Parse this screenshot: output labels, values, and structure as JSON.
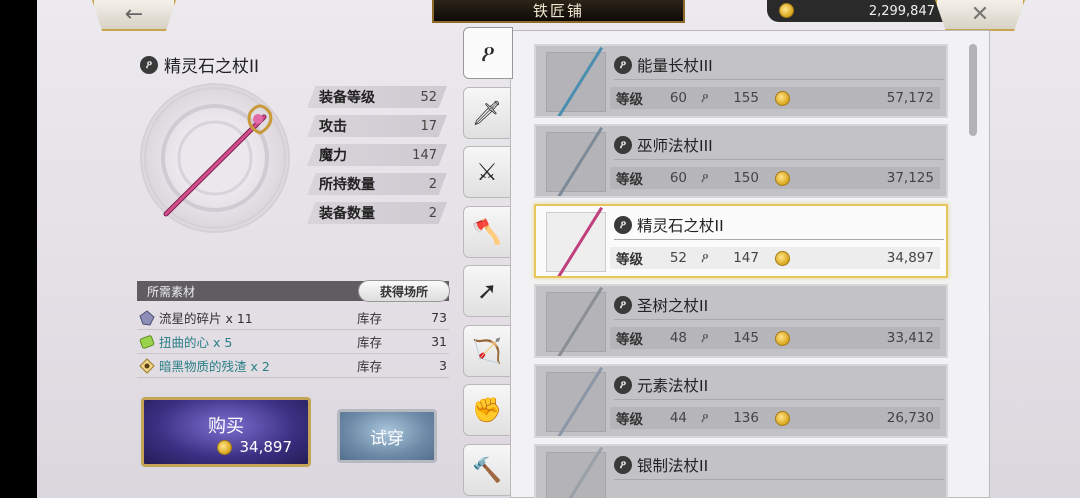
{
  "header": {
    "back_icon": "←",
    "title": "铁匠铺",
    "gold": "2,299,847",
    "close_icon": "✕"
  },
  "detail": {
    "name": "精灵石之杖II",
    "stats": [
      {
        "label": "装备等级",
        "value": "52"
      },
      {
        "label": "攻击",
        "value": "17"
      },
      {
        "label": "魔力",
        "value": "147"
      },
      {
        "label": "所持数量",
        "value": "2"
      },
      {
        "label": "装备数量",
        "value": "2"
      }
    ],
    "materials_title": "所需素材",
    "obtain_label": "获得场所",
    "materials": [
      {
        "name": "流星的碎片 x 11",
        "stock_label": "库存",
        "stock": "73",
        "color": "#333333"
      },
      {
        "name": "扭曲的心 x 5",
        "stock_label": "库存",
        "stock": "31",
        "color": "#2a7f86"
      },
      {
        "name": "暗黑物质的残渣 x 2",
        "stock_label": "库存",
        "stock": "3",
        "color": "#2a7f86"
      }
    ],
    "buy_label": "购买",
    "buy_price": "34,897",
    "try_label": "试穿"
  },
  "tabs": [
    {
      "name": "tab-staff",
      "icon": "staff-icon",
      "glyph": "ዖ"
    },
    {
      "name": "tab-sword",
      "icon": "sword-icon",
      "glyph": "🗡"
    },
    {
      "name": "tab-blade",
      "icon": "curved-blade-icon",
      "glyph": "⚔"
    },
    {
      "name": "tab-axe",
      "icon": "axe-icon",
      "glyph": "🪓"
    },
    {
      "name": "tab-spear",
      "icon": "spear-icon",
      "glyph": "➚"
    },
    {
      "name": "tab-bow",
      "icon": "bow-icon",
      "glyph": "🏹"
    },
    {
      "name": "tab-fist",
      "icon": "fist-icon",
      "glyph": "✊"
    },
    {
      "name": "tab-hammer",
      "icon": "hammer-icon",
      "glyph": "🔨"
    }
  ],
  "list": {
    "level_label": "等级",
    "items": [
      {
        "name": "能量长杖III",
        "level": "60",
        "magic": "155",
        "price": "57,172",
        "selected": false,
        "staff_color": "#4a8fb0"
      },
      {
        "name": "巫师法杖III",
        "level": "60",
        "magic": "150",
        "price": "37,125",
        "selected": false,
        "staff_color": "#7d8a98"
      },
      {
        "name": "精灵石之杖II",
        "level": "52",
        "magic": "147",
        "price": "34,897",
        "selected": true,
        "staff_color": "#c0407e"
      },
      {
        "name": "圣树之杖II",
        "level": "48",
        "magic": "145",
        "price": "33,412",
        "selected": false,
        "staff_color": "#8a8f96"
      },
      {
        "name": "元素法杖II",
        "level": "44",
        "magic": "136",
        "price": "26,730",
        "selected": false,
        "staff_color": "#8c96a6"
      },
      {
        "name": "银制法杖II",
        "level": "",
        "magic": "",
        "price": "",
        "selected": false,
        "staff_color": "#9aa0a8"
      }
    ]
  },
  "colors": {
    "accent_gold": "#e7c75a",
    "buy_purple": "#3b2f82",
    "teal_text": "#2a7f86"
  }
}
